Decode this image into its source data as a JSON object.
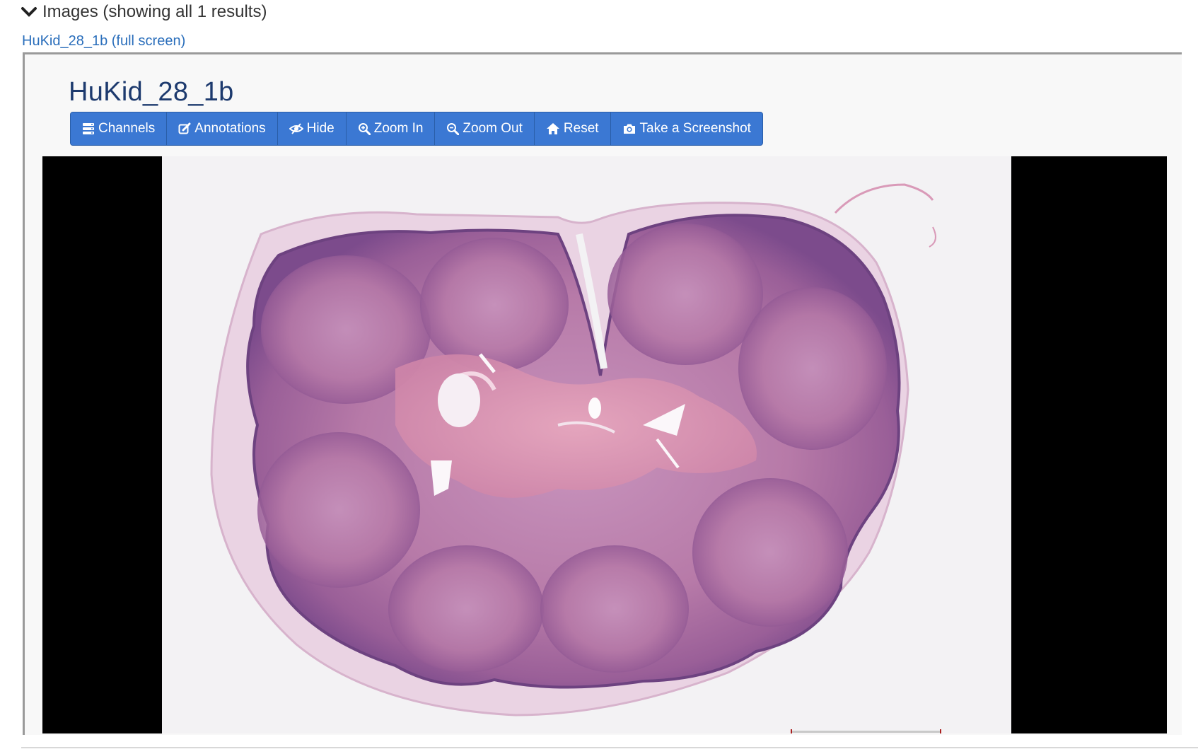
{
  "section": {
    "title": "Images (showing all 1 results)",
    "icon": "chevron-down-icon"
  },
  "image_link": "HuKid_28_1b (full screen)",
  "viewer": {
    "title": "HuKid_28_1b",
    "toolbar": [
      {
        "label": "Channels",
        "icon": "channels-icon"
      },
      {
        "label": "Annotations",
        "icon": "annotate-icon"
      },
      {
        "label": "Hide",
        "icon": "hide-icon"
      },
      {
        "label": "Zoom In",
        "icon": "zoom-in-icon"
      },
      {
        "label": "Zoom Out",
        "icon": "zoom-out-icon"
      },
      {
        "label": "Reset",
        "icon": "home-icon"
      },
      {
        "label": "Take a Screenshot",
        "icon": "camera-icon"
      }
    ]
  },
  "colors": {
    "button_bg": "#3b78d3",
    "title": "#1d3a6e",
    "link": "#2a6ebb",
    "tissue": "#b46fa3",
    "tissue_dark": "#7c4b8c"
  }
}
